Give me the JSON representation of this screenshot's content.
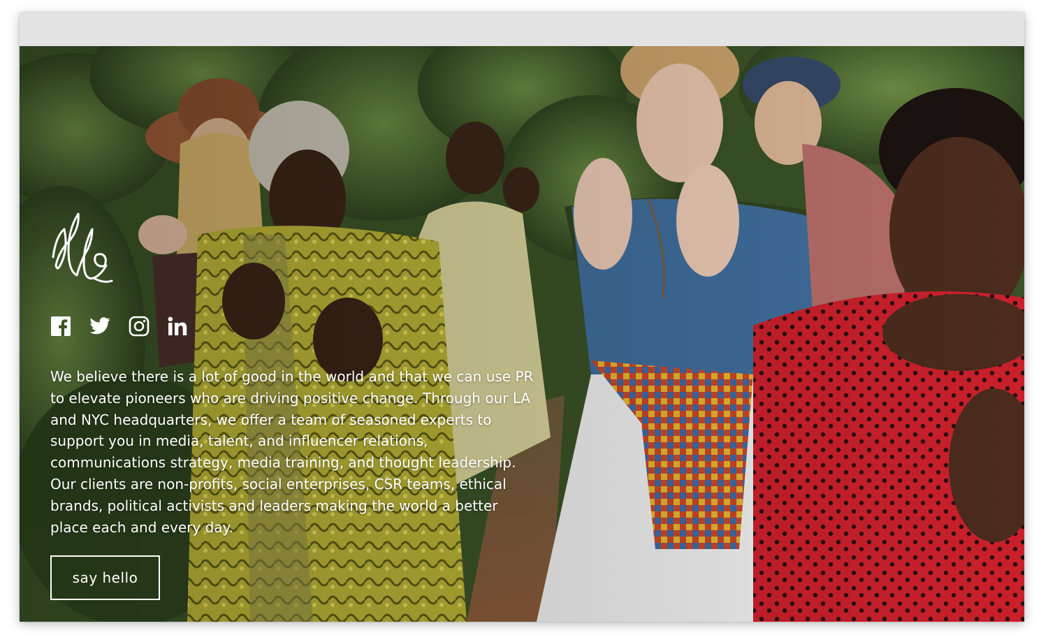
{
  "hero": {
    "blurb": "We believe there is a lot of good in the world and that we can use PR to elevate pioneers who are driving positive change. Through our LA and NYC headquarters, we offer a team of seasoned experts to support you in media, talent, and influencer relations, communications strategy, media training, and thought leadership. Our clients are non-profits, social enterprises, CSR teams, ethical brands, political activists and leaders making the world a better place each and every day.",
    "cta_label": "say hello"
  },
  "logo": {
    "text": "elle",
    "icon": "elle-script-logo"
  },
  "social": {
    "items": [
      {
        "name": "facebook",
        "icon": "facebook-icon"
      },
      {
        "name": "twitter",
        "icon": "twitter-icon"
      },
      {
        "name": "instagram",
        "icon": "instagram-icon"
      },
      {
        "name": "linkedin",
        "icon": "linkedin-icon",
        "glyph": "in"
      }
    ]
  },
  "colors": {
    "text": "#ffffff",
    "chrome": "#e3e3e3",
    "foliage": "#3f5a2a",
    "dress_blue": "#3b6a9a",
    "dress_red": "#c8202a",
    "dress_yellow": "#a7a63a"
  }
}
